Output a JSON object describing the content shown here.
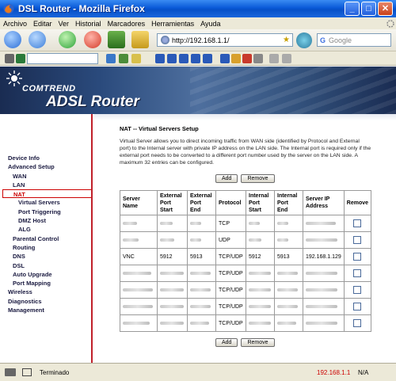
{
  "window": {
    "title": "DSL Router - Mozilla Firefox"
  },
  "menubar": [
    "Archivo",
    "Editar",
    "Ver",
    "Historial",
    "Marcadores",
    "Herramientas",
    "Ayuda"
  ],
  "navbar": {
    "url": "http://192.168.1.1/",
    "search_placeholder": "Google"
  },
  "banner": {
    "brand": "COMTREND",
    "product": "ADSL Router"
  },
  "sidebar": {
    "items": [
      {
        "label": "Device Info",
        "level": 1
      },
      {
        "label": "Advanced Setup",
        "level": 1
      },
      {
        "label": "WAN",
        "level": 2
      },
      {
        "label": "LAN",
        "level": 2
      },
      {
        "label": "NAT",
        "level": 2,
        "active": true
      },
      {
        "label": "Virtual Servers",
        "level": 3
      },
      {
        "label": "Port Triggering",
        "level": 3
      },
      {
        "label": "DMZ Host",
        "level": 3
      },
      {
        "label": "ALG",
        "level": 3
      },
      {
        "label": "Parental Control",
        "level": 2
      },
      {
        "label": "Routing",
        "level": 2
      },
      {
        "label": "DNS",
        "level": 2
      },
      {
        "label": "DSL",
        "level": 2
      },
      {
        "label": "Auto Upgrade",
        "level": 2
      },
      {
        "label": "Port Mapping",
        "level": 2
      },
      {
        "label": "Wireless",
        "level": 1
      },
      {
        "label": "Diagnostics",
        "level": 1
      },
      {
        "label": "Management",
        "level": 1
      }
    ]
  },
  "main": {
    "title": "NAT -- Virtual Servers Setup",
    "description": "Virtual Server allows you to direct incoming traffic from WAN side (identified by Protocol and External port) to the Internal server with private IP address on the LAN side. The Internal port is required only if the external port needs to be converted to a different port number used by the server on the LAN side. A maximum 32 entries can be configured.",
    "add_label": "Add",
    "remove_label": "Remove",
    "table": {
      "headers": [
        "Server Name",
        "External Port Start",
        "External Port End",
        "Protocol",
        "Internal Port Start",
        "Internal Port End",
        "Server IP Address",
        "Remove"
      ],
      "rows": [
        {
          "name": "",
          "ext_start": "",
          "ext_end": "",
          "protocol": "TCP",
          "int_start": "",
          "int_end": "",
          "ip": ""
        },
        {
          "name": "",
          "ext_start": "",
          "ext_end": "",
          "protocol": "UDP",
          "int_start": "",
          "int_end": "",
          "ip": ""
        },
        {
          "name": "VNC",
          "ext_start": "5912",
          "ext_end": "5913",
          "protocol": "TCP/UDP",
          "int_start": "5912",
          "int_end": "5913",
          "ip": "192.168.1.129"
        },
        {
          "name": "",
          "ext_start": "",
          "ext_end": "",
          "protocol": "TCP/UDP",
          "int_start": "",
          "int_end": "",
          "ip": ""
        },
        {
          "name": "",
          "ext_start": "",
          "ext_end": "",
          "protocol": "TCP/UDP",
          "int_start": "",
          "int_end": "",
          "ip": ""
        },
        {
          "name": "",
          "ext_start": "",
          "ext_end": "",
          "protocol": "TCP/UDP",
          "int_start": "",
          "int_end": "",
          "ip": ""
        },
        {
          "name": "",
          "ext_start": "",
          "ext_end": "",
          "protocol": "TCP/UDP",
          "int_start": "",
          "int_end": "",
          "ip": ""
        }
      ]
    }
  },
  "statusbar": {
    "text": "Terminado",
    "ip": "192.168.1.1",
    "na": "N/A"
  },
  "colors": {
    "accent_red": "#c00000",
    "banner_blue": "#2a4a7c",
    "titlebar_blue": "#0a5ad8"
  }
}
